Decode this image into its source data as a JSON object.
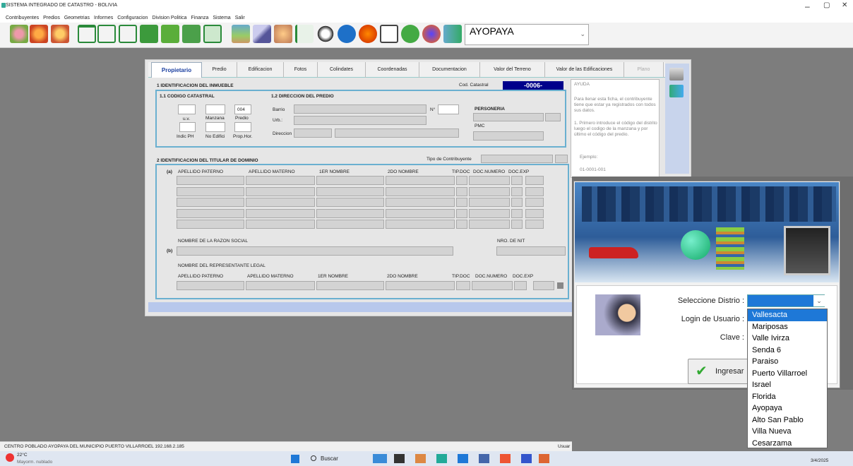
{
  "window": {
    "title": "SISTEMA INTEGRADO DE CATASTRO - BOLIVIA",
    "min": "–",
    "max": "▢",
    "close": "✕"
  },
  "menu": [
    "Contribuyentes",
    "Predios",
    "Geometrias",
    "Informes",
    "Configuracion",
    "Division Politica",
    "Finanza",
    "Sistema",
    "Salir"
  ],
  "toolbar": {
    "location": "AYOPAYA",
    "combo_arrow": "⌄"
  },
  "tabs": [
    "Propietario",
    "Predio",
    "Edificacion",
    "Fotos",
    "Colindates",
    "Coordenadas",
    "Documentacion",
    "Valor del Terreno",
    "Valor de las Edificaciones",
    "Plano"
  ],
  "form": {
    "sec1": "1 IDENTIFICACION DEL INMUEBLE",
    "cod_label": "Cod. Catastral",
    "cod_value": "-0006-",
    "sub11": "1.1 CODIGO CATASTRAL",
    "sub12": "1.2 DIRECCION DEL PREDIO",
    "uv": "u.v.",
    "manzana": "Manzana",
    "predio": "Predio",
    "predio_val": "004",
    "indic": "Indic PH",
    "noedif": "No Edifici",
    "prophor": "Prop.Hor.",
    "barrio": "Barrio",
    "urb": "Urb.:",
    "direccion": "Direccion",
    "numero": "N°",
    "personeria": "PERSONERIA",
    "pmc": "PMC",
    "sec2": "2 IDENTIFICACION DEL TITULAR DE DOMINIO",
    "tipo": "Tipo de Contribuyente",
    "a": "(a)",
    "b": "(b)",
    "cols": [
      "APELLIDO PATERNO",
      "APELLIDO MATERNO",
      "1ER NOMBRE",
      "2DO NOMBRE",
      "TIP.DOC",
      "DOC.NUMERO",
      "DOC.EXP"
    ],
    "razon": "NOMBRE DE LA RAZON SOCIAL",
    "nit": "NRO. DE NIT",
    "rep": "NOMBRE DEL REPRESENTANTE LEGAL",
    "cols2": [
      "APELLIDO PATERNO",
      "APELLIDO MATERNO",
      "1ER NOMBRE",
      "2DO NOMBRE",
      "TIP.DOC",
      "DOC.NUMERO",
      "DOC.EXP"
    ]
  },
  "ayuda": {
    "title": "AYUDA",
    "p1": "Para llenar esta ficha, el contribuyente tiene que estar ya registrados con todos sus datos.",
    "p2": "1. Primero introduce el código del distrito luego el codigo de la manzana y por último el código del predio.",
    "p3": "Ejemplo:",
    "p4": "01-0001-001"
  },
  "status": "CENTRO POBLADO AYOPAYA DEL MUNICIPIO PUERTO VILLARROEL 192.168.2.185",
  "status_user": "Usuar",
  "taskbar": {
    "temp": "22°C",
    "weather": "Mayorm. nublado",
    "search": "Buscar",
    "date": "3/4/2025"
  },
  "login": {
    "distrito_label": "Seleccione Distrio :",
    "usuario_label": "Login de Usuario :",
    "clave_label": "Clave :",
    "button": "Ingresar",
    "arrow": "⌄",
    "options": [
      "Vallesacta",
      "Mariposas",
      "Valle Ivirza",
      "Senda 6",
      "Paraiso",
      "Puerto Villarroel",
      "Israel",
      "Florida",
      "Ayopaya",
      "Alto San Pablo",
      "Villa Nueva",
      "Cesarzama"
    ],
    "selected": "Vallesacta"
  },
  "colors": {
    "accent": "#1e78d7",
    "code_bg": "#00008b",
    "section_border": "#6ab0d0"
  }
}
